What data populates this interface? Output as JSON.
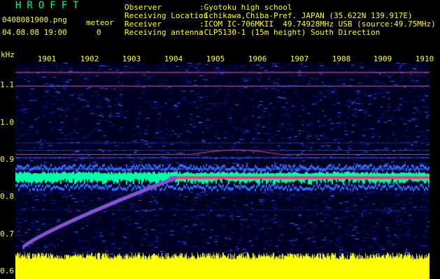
{
  "app": {
    "title": "HROFFT"
  },
  "file": {
    "name": "0408081900.png",
    "datetime": "04.08.08 19:00",
    "meteor_label": "meteor",
    "meteor_count": "0"
  },
  "observer": {
    "label": "Observer",
    "value": ":Gyotoku high school"
  },
  "location": {
    "label": "Receiving Location",
    "value": ":Ichikawa,Chiba-Pref. JAPAN (35.622N 139.917E)"
  },
  "receiver": {
    "label": "Receiver",
    "value": ":ICOM IC-706MKII  49.74928MHz USB (source:49.75MHz)"
  },
  "antenna": {
    "label": "Receiving antenna",
    "value": ":CLP5130-1 (15m height) South Direction"
  },
  "chart_data": {
    "type": "heatmap",
    "ylabel": "kHz",
    "x_ticks": [
      "1901",
      "1902",
      "1903",
      "1904",
      "1905",
      "1906",
      "1907",
      "1908",
      "1909",
      "1910"
    ],
    "y_ticks": [
      "1.1",
      "1.0",
      "0.9",
      "0.8",
      "0.7",
      "0.6"
    ],
    "ylim": [
      0.58,
      1.16
    ],
    "colors": {
      "background": "#000022",
      "noise_low": "#0022aa",
      "noise_mid": "#3366ff",
      "strong": "#00ffaa",
      "peak": "#ff3377",
      "amplitude": "#ffff00"
    }
  }
}
